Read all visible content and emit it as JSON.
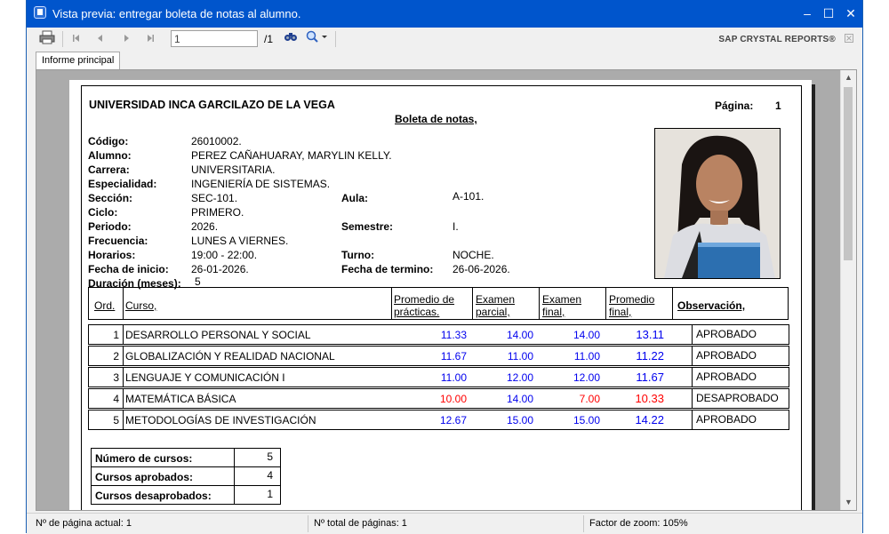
{
  "window": {
    "title": "Vista previa: entregar boleta de notas al alumno.",
    "controls": {
      "minimize": "–",
      "maximize": "☐",
      "close": "✕"
    }
  },
  "toolbar": {
    "page_value": "1",
    "page_total": "/1",
    "brand": "SAP CRYSTAL REPORTS®",
    "icons": [
      "print-icon",
      "first-page-icon",
      "previous-page-icon",
      "next-page-icon",
      "last-page-icon",
      "find-icon",
      "zoom-icon",
      "close-tab-icon"
    ]
  },
  "tab": {
    "label": "Informe principal"
  },
  "report": {
    "university": "UNIVERSIDAD INCA GARCILAZO DE LA VEGA",
    "title": "Boleta de notas,",
    "page_label": "Página:",
    "page_number": "1",
    "fields": {
      "codigo_label": "Código:",
      "codigo": "26010002.",
      "alumno_label": "Alumno:",
      "alumno": "PEREZ CAÑAHUARAY, MARYLIN KELLY.",
      "carrera_label": "Carrera:",
      "carrera": "UNIVERSITARIA.",
      "especialidad_label": "Especialidad:",
      "especialidad": "INGENIERÍA DE SISTEMAS.",
      "seccion_label": "Sección:",
      "seccion": "SEC-101.",
      "aula_label": "Aula:",
      "aula": "A-101.",
      "ciclo_label": "Ciclo:",
      "ciclo": "PRIMERO.",
      "periodo_label": "Periodo:",
      "periodo": "2026.",
      "semestre_label": "Semestre:",
      "semestre": "I.",
      "frecuencia_label": "Frecuencia:",
      "frecuencia": "LUNES A VIERNES.",
      "horarios_label": "Horarios:",
      "horarios": "19:00 - 22:00.",
      "turno_label": "Turno:",
      "turno": "NOCHE.",
      "fecha_inicio_label": "Fecha de inicio:",
      "fecha_inicio": "26-01-2026.",
      "fecha_termino_label": "Fecha de termino:",
      "fecha_termino": "26-06-2026.",
      "duracion_label": "Duración (meses):",
      "duracion": "5"
    },
    "table": {
      "headers": {
        "ord": "Ord.",
        "curso": "Curso,",
        "prom_prac_1": "Promedio de",
        "prom_prac_2": "prácticas.",
        "ex_parcial_1": "Examen",
        "ex_parcial_2": "parcial,",
        "ex_final_1": "Examen",
        "ex_final_2": "final,",
        "prom_final_1": "Promedio",
        "prom_final_2": "final,",
        "observacion": "Observación,"
      },
      "rows": [
        {
          "ord": "1",
          "curso": "DESARROLLO PERSONAL Y SOCIAL",
          "practicas": "11.33",
          "parcial": "14.00",
          "final": "14.00",
          "promedio": "13.11",
          "observacion": "APROBADO"
        },
        {
          "ord": "2",
          "curso": "GLOBALIZACIÓN Y REALIDAD NACIONAL",
          "practicas": "11.67",
          "parcial": "11.00",
          "final": "11.00",
          "promedio": "11.22",
          "observacion": "APROBADO"
        },
        {
          "ord": "3",
          "curso": "LENGUAJE Y COMUNICACIÓN I",
          "practicas": "11.00",
          "parcial": "12.00",
          "final": "12.00",
          "promedio": "11.67",
          "observacion": "APROBADO"
        },
        {
          "ord": "4",
          "curso": "MATEMÁTICA BÁSICA",
          "practicas": "10.00",
          "parcial": "14.00",
          "final": "7.00",
          "promedio": "10.33",
          "observacion": "DESAPROBADO"
        },
        {
          "ord": "5",
          "curso": "METODOLOGÍAS DE INVESTIGACIÓN",
          "practicas": "12.67",
          "parcial": "15.00",
          "final": "15.00",
          "promedio": "14.22",
          "observacion": "APROBADO"
        }
      ]
    },
    "summary": {
      "numero_label": "Número de cursos:",
      "numero": "5",
      "aprobados_label": "Cursos aprobados:",
      "aprobados": "4",
      "desaprobados_label": "Cursos desaprobados:",
      "desaprobados": "1"
    }
  },
  "status": {
    "current_page": "Nº de página actual: 1",
    "total_pages": "Nº total de páginas: 1",
    "zoom": "Factor de zoom: 105%"
  },
  "colors": {
    "pass": "#0000ee",
    "fail": "#ff0000",
    "titlebar": "#0055cc"
  }
}
